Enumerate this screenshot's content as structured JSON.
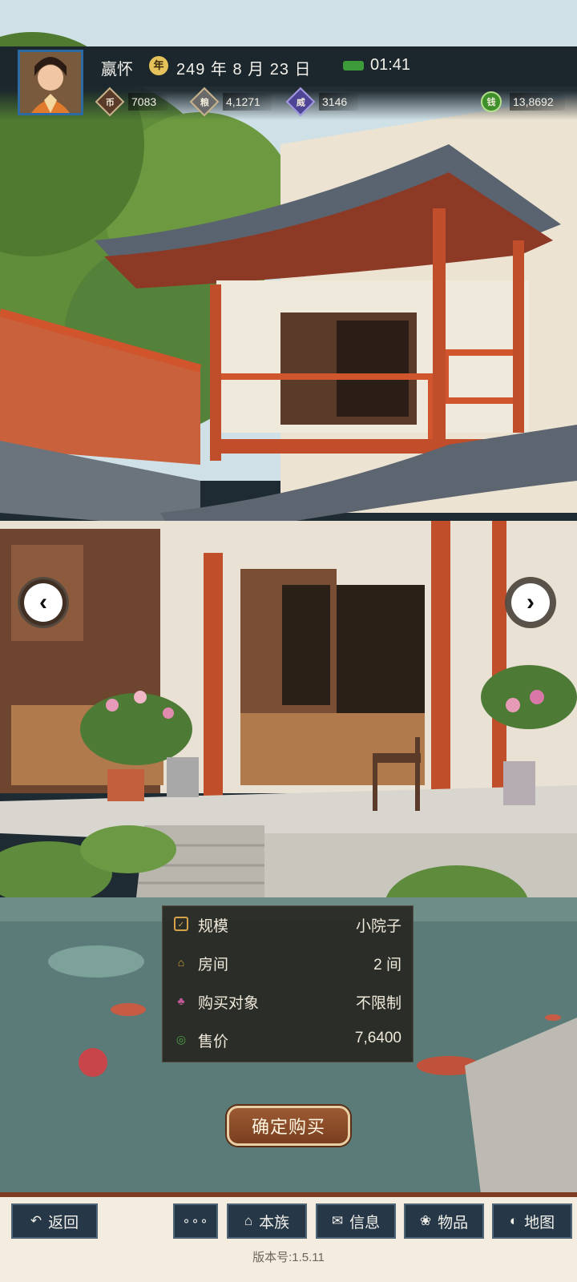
{
  "player": {
    "name": "嬴怀"
  },
  "date": {
    "text": "249 年 8 月 23 日",
    "time": "01:41"
  },
  "resources": [
    {
      "value": "7083",
      "icon": "coin-bag-icon"
    },
    {
      "value": "4,1271",
      "icon": "grain-icon"
    },
    {
      "value": "3146",
      "icon": "influence-icon"
    },
    {
      "value": "13,8692",
      "icon": "money-pouch-icon"
    }
  ],
  "property": {
    "rows": [
      {
        "label": "规模",
        "value": "小院子",
        "icon": "scale-icon"
      },
      {
        "label": "房间",
        "value": "2 间",
        "icon": "room-icon"
      },
      {
        "label": "购买对象",
        "value": "不限制",
        "icon": "buyer-icon"
      },
      {
        "label": "售价",
        "value": "7,6400",
        "icon": "price-icon"
      }
    ],
    "buy_label": "确定购买"
  },
  "nav": {
    "back": "返回",
    "clan": "本族",
    "info": "信息",
    "items": "物品",
    "map": "地图"
  },
  "version": "版本号:1.5.11"
}
